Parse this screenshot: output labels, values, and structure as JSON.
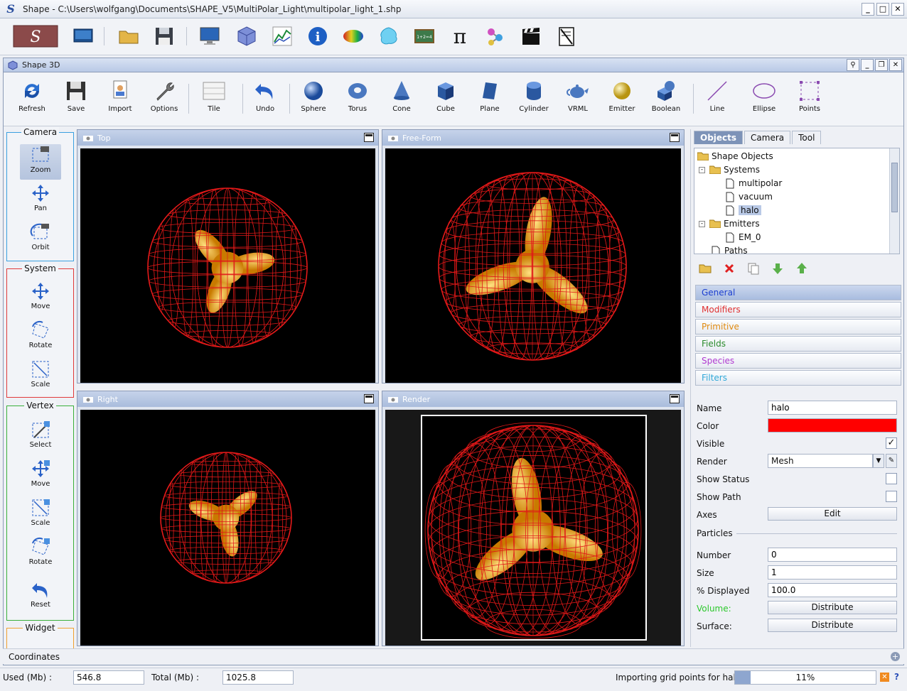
{
  "window": {
    "title": "Shape - C:\\Users\\wolfgang\\Documents\\SHAPE_V5\\MultiPolar_Light\\multipolar_light_1.shp"
  },
  "window_controls": [
    "_",
    "□",
    "✕"
  ],
  "app_tools": [
    "splash-logo",
    "desktop",
    "open-folder",
    "save-disk",
    "monitor",
    "3d-cube",
    "graph",
    "info",
    "ellipse-color",
    "splash",
    "chalkboard",
    "pi",
    "molecule",
    "clapper",
    "document"
  ],
  "frame": {
    "title": "Shape 3D"
  },
  "shape_toolbar": [
    {
      "id": "refresh",
      "label": "Refresh"
    },
    {
      "id": "save",
      "label": "Save"
    },
    {
      "id": "import",
      "label": "Import"
    },
    {
      "id": "options",
      "label": "Options"
    },
    {
      "id": "tile",
      "label": "Tile"
    },
    {
      "id": "undo",
      "label": "Undo"
    },
    {
      "id": "sphere",
      "label": "Sphere"
    },
    {
      "id": "torus",
      "label": "Torus"
    },
    {
      "id": "cone",
      "label": "Cone"
    },
    {
      "id": "cube",
      "label": "Cube"
    },
    {
      "id": "plane",
      "label": "Plane"
    },
    {
      "id": "cylinder",
      "label": "Cylinder"
    },
    {
      "id": "vrml",
      "label": "VRML"
    },
    {
      "id": "emitter",
      "label": "Emitter"
    },
    {
      "id": "boolean",
      "label": "Boolean"
    },
    {
      "id": "line",
      "label": "Line"
    },
    {
      "id": "ellipse",
      "label": "Ellipse"
    },
    {
      "id": "points",
      "label": "Points"
    }
  ],
  "left_groups": {
    "camera": {
      "title": "Camera",
      "color": "#3aa0e0",
      "tools": [
        "Zoom",
        "Pan",
        "Orbit"
      ]
    },
    "system": {
      "title": "System",
      "color": "#e03a3a",
      "tools": [
        "Move",
        "Rotate",
        "Scale"
      ]
    },
    "vertex": {
      "title": "Vertex",
      "color": "#3ab03a",
      "tools": [
        "Select",
        "Move",
        "Scale",
        "Rotate",
        "Reset"
      ]
    },
    "widget": {
      "title": "Widget",
      "color": "#f0a030",
      "tools": []
    }
  },
  "viewports": {
    "top": "Top",
    "free": "Free-Form",
    "right": "Right",
    "render": "Render"
  },
  "right_panel": {
    "tabs": [
      "Objects",
      "Camera",
      "Tool"
    ],
    "tree": {
      "root": "Shape Objects",
      "systems": "Systems",
      "items": [
        "multipolar",
        "vacuum",
        "halo"
      ],
      "emitters": "Emitters",
      "emitter_items": [
        "EM_0"
      ],
      "paths": "Paths"
    },
    "accordion": [
      {
        "label": "General",
        "color": "#1c3fd0"
      },
      {
        "label": "Modifiers",
        "color": "#e03030"
      },
      {
        "label": "Primitive",
        "color": "#e08a10"
      },
      {
        "label": "Fields",
        "color": "#2a8a2a"
      },
      {
        "label": "Species",
        "color": "#b03ad0"
      },
      {
        "label": "Filters",
        "color": "#30a8d8"
      }
    ],
    "props": {
      "name_label": "Name",
      "name": "halo",
      "color_label": "Color",
      "color": "#ff0000",
      "visible_label": "Visible",
      "render_label": "Render",
      "render": "Mesh",
      "show_status_label": "Show Status",
      "show_path_label": "Show Path",
      "axes_label": "Axes",
      "axes_btn": "Edit",
      "particles_label": "Particles",
      "number_label": "Number",
      "number": "0",
      "size_label": "Size",
      "size": "1",
      "displayed_label": "% Displayed",
      "displayed": "100.0",
      "volume_label": "Volume:",
      "volume_btn": "Distribute",
      "surface_label": "Surface:",
      "surface_btn": "Distribute"
    }
  },
  "coordinates_label": "Coordinates",
  "status": {
    "used_label": "Used (Mb) :",
    "used": "546.8",
    "total_label": "Total (Mb) :",
    "total": "1025.8",
    "message": "Importing grid points for halo",
    "progress_pct": 11,
    "progress_text": "11%",
    "help": "?"
  }
}
